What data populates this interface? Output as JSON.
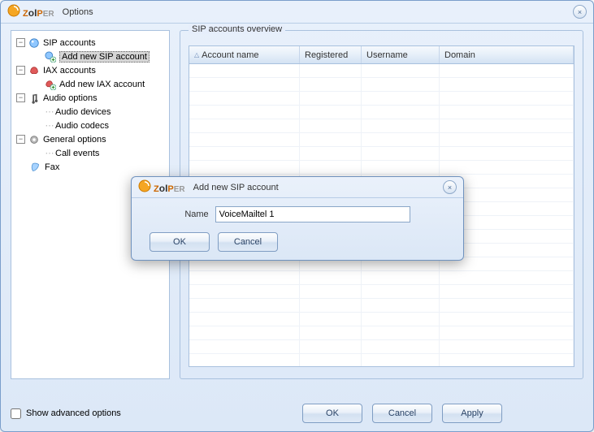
{
  "window": {
    "app_name_parts": {
      "z": "Z",
      "oi": "oI",
      "p": "P",
      "er": "ER"
    },
    "title": "Options",
    "close": "×"
  },
  "tree": {
    "sip": {
      "label": "SIP accounts",
      "add": "Add new SIP account"
    },
    "iax": {
      "label": "IAX accounts",
      "add": "Add new IAX account"
    },
    "audio": {
      "label": "Audio options",
      "devices": "Audio devices",
      "codecs": "Audio codecs"
    },
    "general": {
      "label": "General options",
      "events": "Call events"
    },
    "fax": {
      "label": "Fax"
    },
    "expander_minus": "−"
  },
  "groupbox": {
    "title": "SIP accounts overview",
    "columns": {
      "name": "Account name",
      "reg": "Registered",
      "user": "Username",
      "domain": "Domain"
    },
    "sort_arrow": "△"
  },
  "dialog": {
    "title": "Add new SIP account",
    "name_label": "Name",
    "name_value": "VoiceMailtel 1",
    "ok": "OK",
    "cancel": "Cancel",
    "close": "×"
  },
  "bottom": {
    "advanced": "Show advanced options",
    "ok": "OK",
    "cancel": "Cancel",
    "apply": "Apply"
  }
}
